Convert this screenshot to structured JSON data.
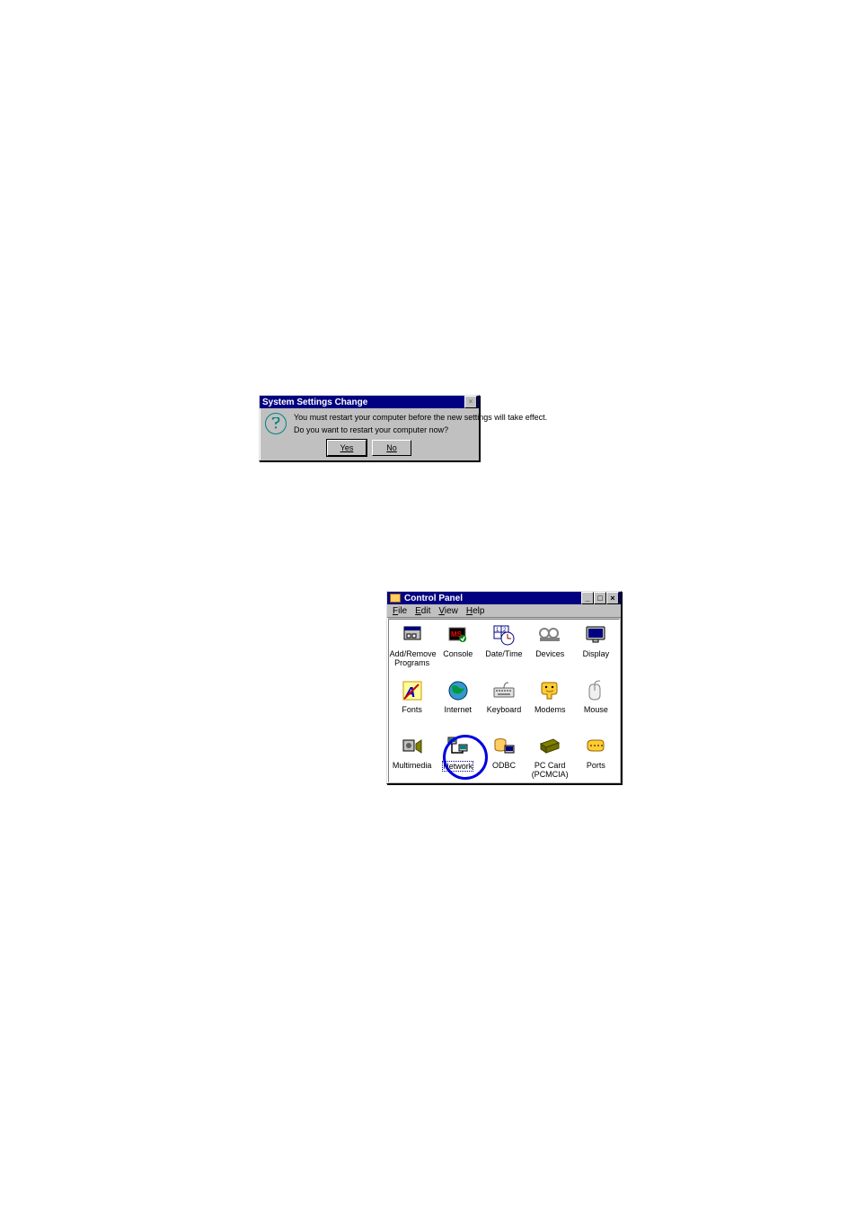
{
  "dialog": {
    "title": "System Settings Change",
    "line1": "You must restart your computer before the new settings will take effect.",
    "line2": "Do you want to restart your computer now?",
    "yes": "Yes",
    "no": "No",
    "close_glyph": "×"
  },
  "cp": {
    "title": "Control Panel",
    "min_glyph": "_",
    "max_glyph": "□",
    "close_glyph": "×",
    "menu": {
      "file": "File",
      "edit": "Edit",
      "view": "View",
      "help": "Help"
    },
    "items": [
      {
        "id": "addremove",
        "label": "Add/Remove Programs"
      },
      {
        "id": "console",
        "label": "Console"
      },
      {
        "id": "datetime",
        "label": "Date/Time"
      },
      {
        "id": "devices",
        "label": "Devices"
      },
      {
        "id": "display",
        "label": "Display"
      },
      {
        "id": "fonts",
        "label": "Fonts"
      },
      {
        "id": "internet",
        "label": "Internet"
      },
      {
        "id": "keyboard",
        "label": "Keyboard"
      },
      {
        "id": "modems",
        "label": "Modems"
      },
      {
        "id": "mouse",
        "label": "Mouse"
      },
      {
        "id": "multimedia",
        "label": "Multimedia"
      },
      {
        "id": "network",
        "label": "Network",
        "selected": true
      },
      {
        "id": "odbc",
        "label": "ODBC"
      },
      {
        "id": "pccard",
        "label": "PC Card (PCMCIA)"
      },
      {
        "id": "ports",
        "label": "Ports"
      }
    ]
  }
}
